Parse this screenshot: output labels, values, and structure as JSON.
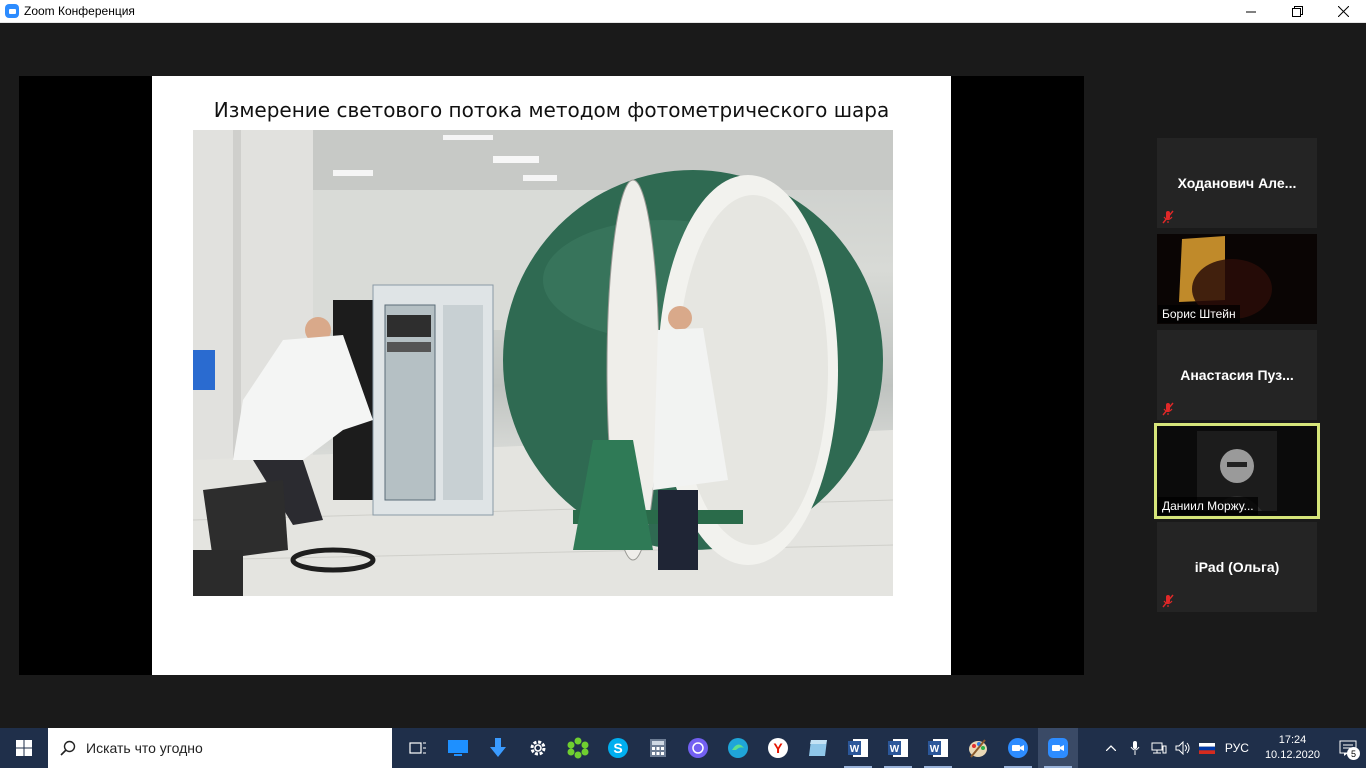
{
  "window": {
    "title": "Zoom Конференция"
  },
  "slide": {
    "title": "Измерение светового потока методом фотометрического шара"
  },
  "participants": [
    {
      "name": "Ходанович  Але...",
      "muted": true,
      "video": false
    },
    {
      "name": "Борис Штейн",
      "muted": false,
      "video": true
    },
    {
      "name": "Анастасия  Пуз...",
      "muted": true,
      "video": false
    },
    {
      "name": "Даниил Моржу...",
      "muted": false,
      "video": true,
      "active": true
    },
    {
      "name": "iPad (Ольга)",
      "muted": true,
      "video": false
    }
  ],
  "taskbar": {
    "search_placeholder": "Искать что угодно",
    "apps": [
      "task-view-icon",
      "desktop-icon",
      "download-icon",
      "settings-icon",
      "icq-icon",
      "skype-icon",
      "calculator-icon",
      "viber-icon",
      "edge-icon",
      "yandex-icon",
      "notes-icon",
      "word-icon",
      "word-icon",
      "word-icon",
      "paint-icon",
      "zoom-icon",
      "zoom-icon"
    ],
    "language": "РУС",
    "time": "17:24",
    "date": "10.12.2020",
    "notifications": "5"
  },
  "colors": {
    "active_speaker": "#d6e57a",
    "taskbar": "#1f2f4a",
    "zoom_blue": "#2d8cff"
  }
}
